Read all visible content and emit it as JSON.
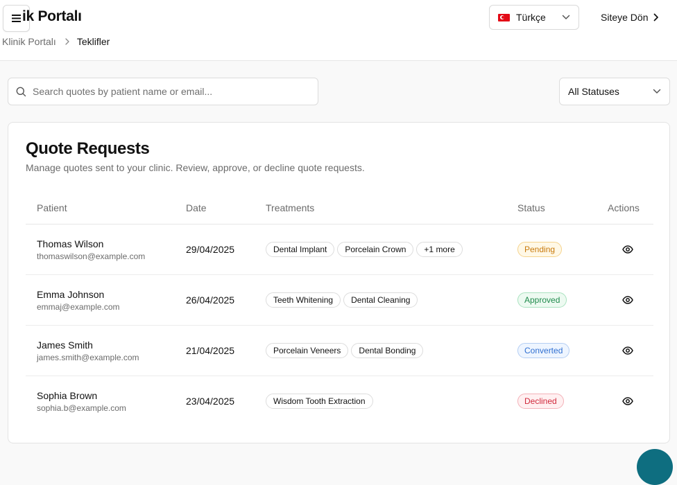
{
  "header": {
    "title": "ik Portalı",
    "language": "Türkçe",
    "back_link": "Siteye Dön"
  },
  "breadcrumb": {
    "root": "Klinik Portalı",
    "current": "Teklifler"
  },
  "search": {
    "placeholder": "Search quotes by patient name or email...",
    "value": ""
  },
  "status_filter": {
    "selected": "All Statuses"
  },
  "card": {
    "title": "Quote Requests",
    "description": "Manage quotes sent to your clinic. Review, approve, or decline quote requests."
  },
  "table": {
    "columns": [
      "Patient",
      "Date",
      "Treatments",
      "Status",
      "Actions"
    ],
    "rows": [
      {
        "name": "Thomas Wilson",
        "email": "thomaswilson@example.com",
        "date": "29/04/2025",
        "treatments": [
          "Dental Implant",
          "Porcelain Crown",
          "+1 more"
        ],
        "status": "Pending",
        "status_colors": {
          "text": "#c87a0c",
          "bg": "#fff8e6",
          "border": "#f5d38c"
        }
      },
      {
        "name": "Emma Johnson",
        "email": "emmaj@example.com",
        "date": "26/04/2025",
        "treatments": [
          "Teeth Whitening",
          "Dental Cleaning"
        ],
        "status": "Approved",
        "status_colors": {
          "text": "#1f8a4c",
          "bg": "#edfaf1",
          "border": "#a9e2bf"
        }
      },
      {
        "name": "James Smith",
        "email": "james.smith@example.com",
        "date": "21/04/2025",
        "treatments": [
          "Porcelain Veneers",
          "Dental Bonding"
        ],
        "status": "Converted",
        "status_colors": {
          "text": "#2f6fd1",
          "bg": "#eef5ff",
          "border": "#b4cef3"
        }
      },
      {
        "name": "Sophia Brown",
        "email": "sophia.b@example.com",
        "date": "23/04/2025",
        "treatments": [
          "Wisdom Tooth Extraction"
        ],
        "status": "Declined",
        "status_colors": {
          "text": "#d0283b",
          "bg": "#fff0f1",
          "border": "#f3b1b8"
        }
      }
    ]
  },
  "icons": {
    "menu": "menu-icon",
    "chevron_down": "chevron-down-icon",
    "chevron_right": "chevron-right-icon",
    "search": "search-icon",
    "view": "eye-icon"
  },
  "colors": {
    "fab": "#0e6e80"
  }
}
